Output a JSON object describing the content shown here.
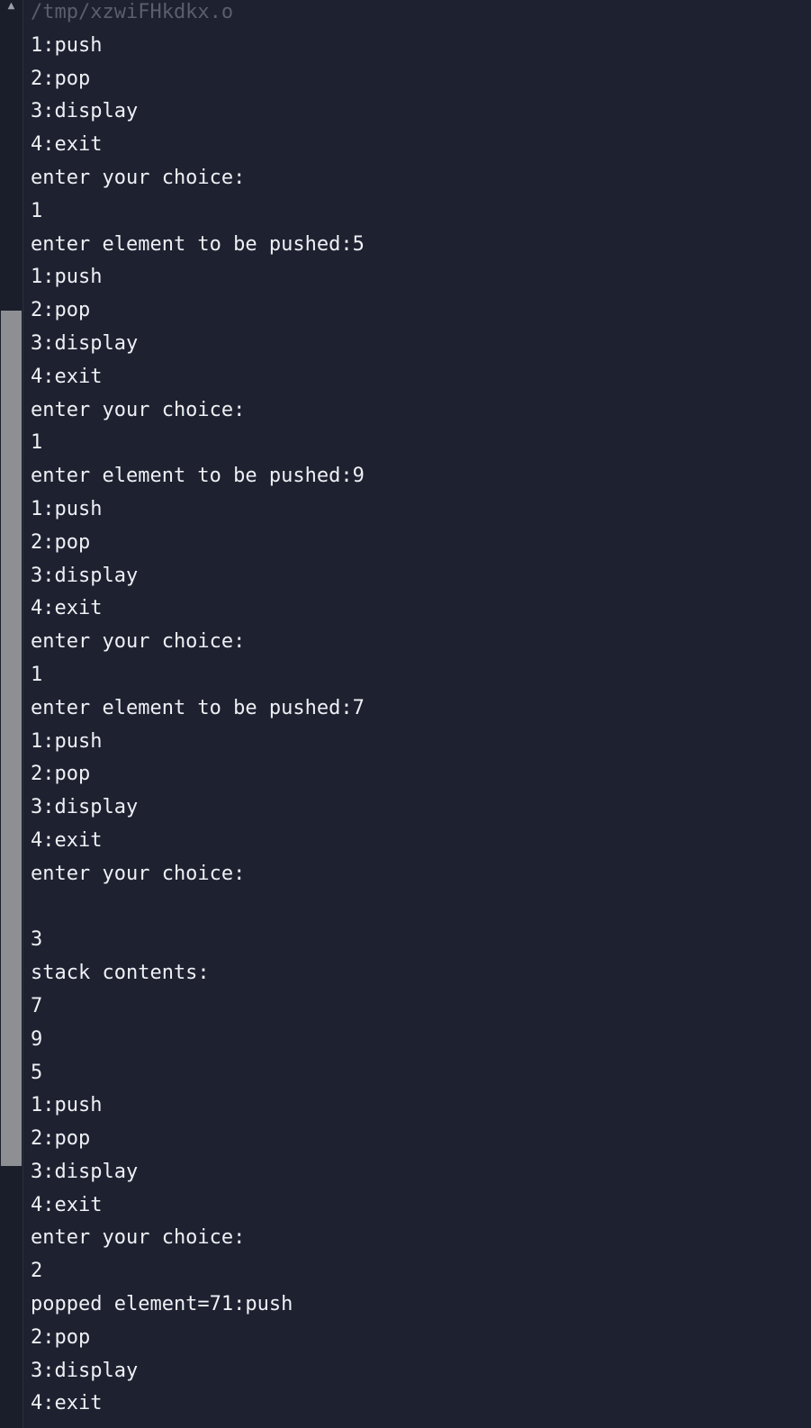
{
  "terminal": {
    "path": "/tmp/xzwiFHkdkx.o",
    "lines": [
      "1:push",
      "2:pop",
      "3:display",
      "4:exit",
      "enter your choice:",
      "1",
      "enter element to be pushed:5",
      "1:push",
      "2:pop",
      "3:display",
      "4:exit",
      "enter your choice:",
      "1",
      "enter element to be pushed:9",
      "1:push",
      "2:pop",
      "3:display",
      "4:exit",
      "enter your choice:",
      "1",
      "enter element to be pushed:7",
      "1:push",
      "2:pop",
      "3:display",
      "4:exit",
      "enter your choice:",
      "",
      "3",
      "stack contents:",
      "7",
      "9",
      "5",
      "1:push",
      "2:pop",
      "3:display",
      "4:exit",
      "enter your choice:",
      "2",
      "popped element=71:push",
      "2:pop",
      "3:display",
      "4:exit"
    ]
  },
  "scrollbar": {
    "up_arrow_icon": "triangle-up",
    "thumb_color": "#8d8f93"
  },
  "colors": {
    "background": "#1d2130",
    "text": "#eef0f4",
    "path_text": "#5a5f6b"
  }
}
